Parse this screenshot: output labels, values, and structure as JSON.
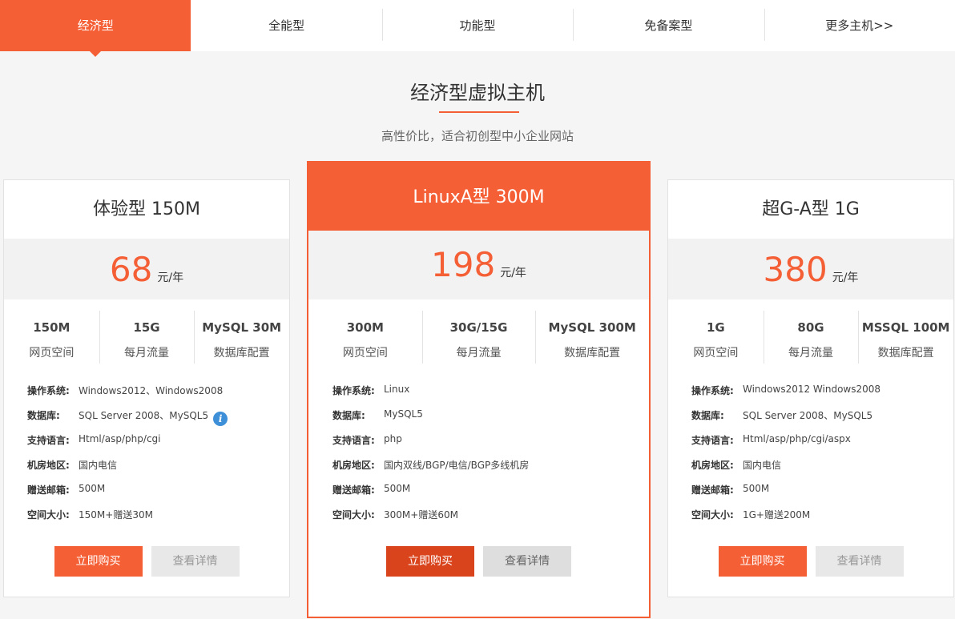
{
  "tabs": [
    "经济型",
    "全能型",
    "功能型",
    "免备案型",
    "更多主机>>"
  ],
  "section": {
    "title": "经济型虚拟主机",
    "subtitle": "高性价比，适合初创型中小企业网站"
  },
  "labels": {
    "web_space": "网页空间",
    "traffic": "每月流量",
    "db_config": "数据库配置",
    "os": "操作系统:",
    "database": "数据库:",
    "language": "支持语言:",
    "region": "机房地区:",
    "mail": "赠送邮箱:",
    "space_size": "空间大小:",
    "buy": "立即购买",
    "detail": "查看详情",
    "unit": "元/年"
  },
  "colors": {
    "accent": "#f55f36",
    "accent_dark": "#d9441d",
    "info": "#3d8fd8"
  },
  "plans": [
    {
      "name": "体验型 150M",
      "price": "68",
      "space": "150M",
      "traffic": "15G",
      "db": "MySQL 30M",
      "os": "Windows2012、Windows2008",
      "database": "SQL Server 2008、MySQL5",
      "language": "Html/asp/php/cgi",
      "region": "国内电信",
      "mail": "500M",
      "space_size": "150M+赠送30M"
    },
    {
      "name": "LinuxA型 300M",
      "price": "198",
      "space": "300M",
      "traffic": "30G/15G",
      "db": "MySQL 300M",
      "os": "Linux",
      "database": "MySQL5",
      "language": "php",
      "region": "国内双线/BGP/电信/BGP多线机房",
      "mail": "500M",
      "space_size": "300M+赠送60M"
    },
    {
      "name": "超G-A型 1G",
      "price": "380",
      "space": "1G",
      "traffic": "80G",
      "db": "MSSQL 100M",
      "os": "Windows2012 Windows2008",
      "database": "SQL Server 2008、MySQL5",
      "language": "Html/asp/php/cgi/aspx",
      "region": "国内电信",
      "mail": "500M",
      "space_size": "1G+赠送200M"
    }
  ]
}
